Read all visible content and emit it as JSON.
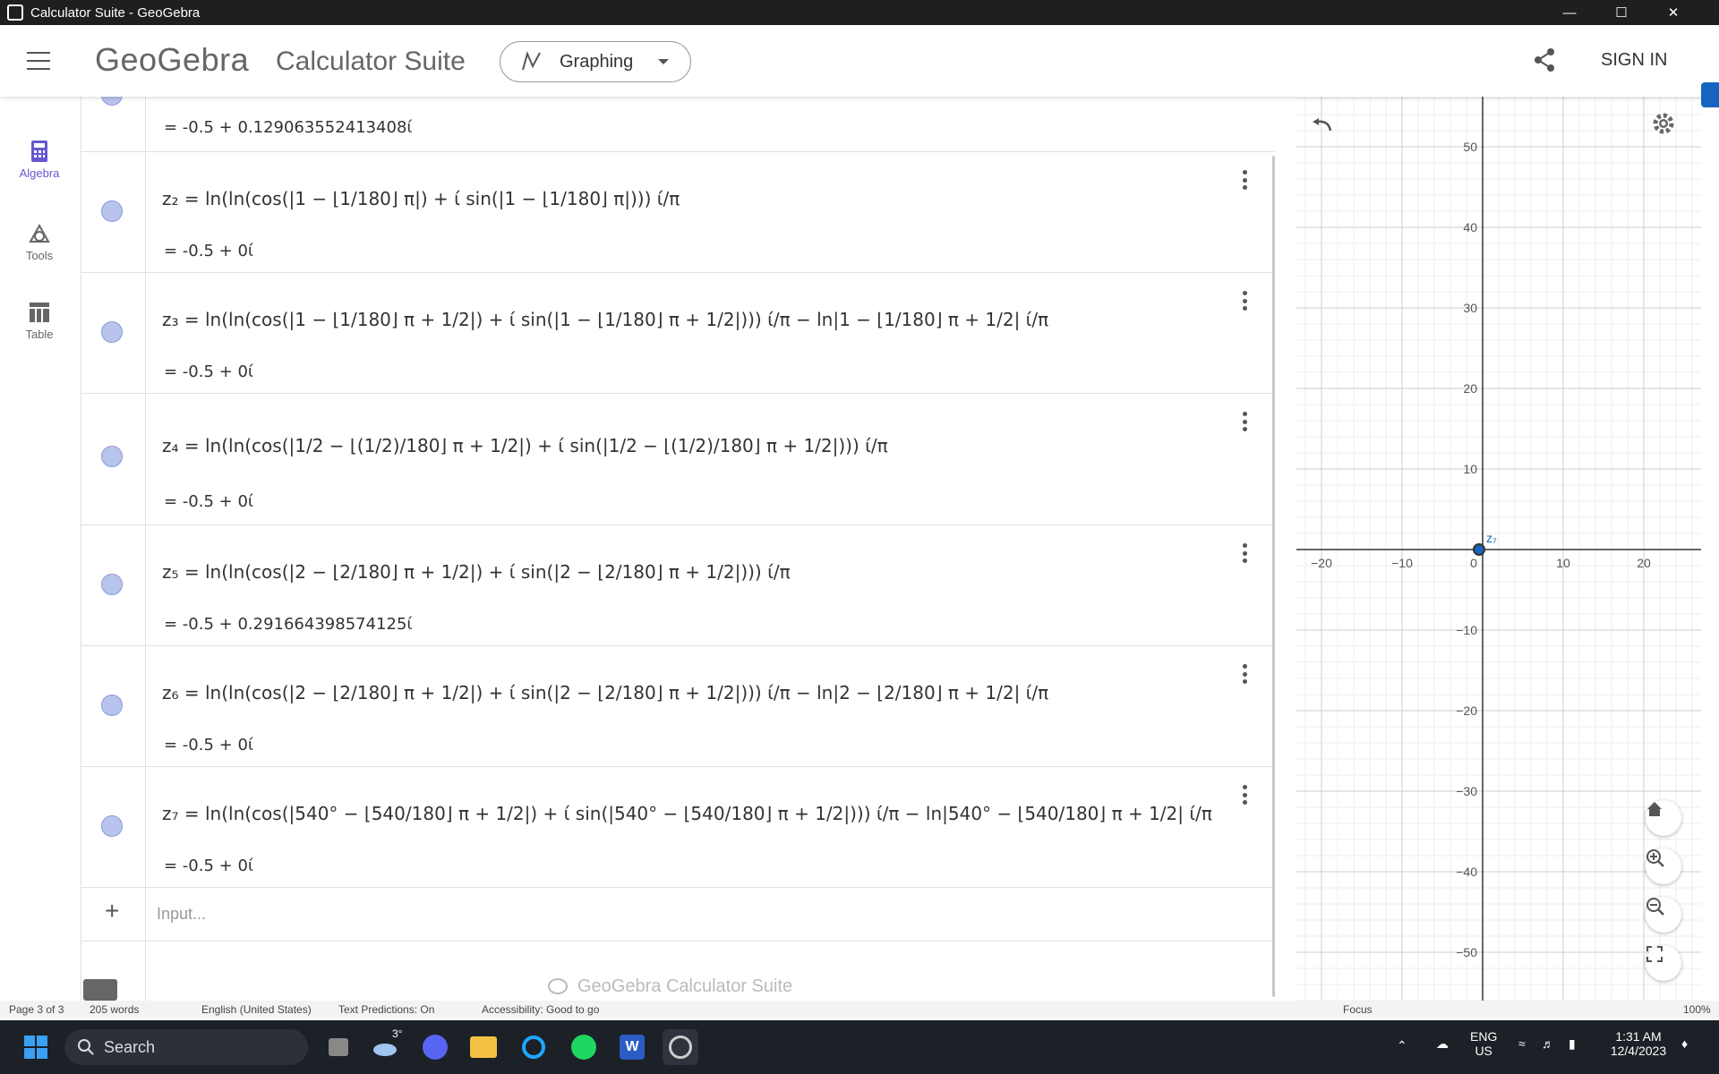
{
  "window": {
    "title": "Calculator Suite - GeoGebra"
  },
  "header": {
    "logo": "GeoGebra",
    "suite_title": "Calculator Suite",
    "app_picker_label": "Graphing",
    "signin_label": "SIGN IN"
  },
  "rail": {
    "items": [
      {
        "label": "Algebra",
        "icon": "calculator-icon"
      },
      {
        "label": "Tools",
        "icon": "tools-icon"
      },
      {
        "label": "Table",
        "icon": "table-icon"
      }
    ]
  },
  "algebra": {
    "rows": [
      {
        "formula": "",
        "result": "= -0.5 + 0.129063552413408ί"
      },
      {
        "formula": "z₂ = ln(ln(cos(|1 − ⌊1/180⌋ π|) + ί sin(|1 − ⌊1/180⌋ π|))) ί/π",
        "result": "= -0.5 + 0ί"
      },
      {
        "formula": "z₃ = ln(ln(cos(|1 − ⌊1/180⌋ π + 1/2|) + ί sin(|1 − ⌊1/180⌋ π + 1/2|))) ί/π − ln|1 − ⌊1/180⌋ π + 1/2| ί/π",
        "result": "= -0.5 + 0ί"
      },
      {
        "formula": "z₄ = ln(ln(cos(|1/2 − ⌊(1/2)/180⌋ π + 1/2|) + ί sin(|1/2 − ⌊(1/2)/180⌋ π + 1/2|))) ί/π",
        "result": "= -0.5 + 0ί"
      },
      {
        "formula": "z₅ = ln(ln(cos(|2 − ⌊2/180⌋ π + 1/2|) + ί sin(|2 − ⌊2/180⌋ π + 1/2|))) ί/π",
        "result": "= -0.5 + 0.291664398574125ί"
      },
      {
        "formula": "z₆ = ln(ln(cos(|2 − ⌊2/180⌋ π + 1/2|) + ί sin(|2 − ⌊2/180⌋ π + 1/2|))) ί/π − ln|2 − ⌊2/180⌋ π + 1/2| ί/π",
        "result": "= -0.5 + 0ί"
      },
      {
        "formula": "z₇ = ln(ln(cos(|540° − ⌊540/180⌋ π + 1/2|) + ί sin(|540° − ⌊540/180⌋ π + 1/2|))) ί/π − ln|540° − ⌊540/180⌋ π + 1/2| ί/π",
        "result": "= -0.5 + 0ί"
      }
    ],
    "input_placeholder": "Input...",
    "footer_brand": "GeoGebra Calculator Suite"
  },
  "graphics": {
    "x_ticks": [
      "−20",
      "−10",
      "0",
      "10",
      "20"
    ],
    "y_ticks": [
      "50",
      "40",
      "30",
      "20",
      "10",
      "−10",
      "−20",
      "−30",
      "−40",
      "−50"
    ],
    "point_label": "z₇"
  },
  "word_status": {
    "page": "Page 3 of 3",
    "words": "205 words",
    "language": "English (United States)",
    "predictions": "Text Predictions: On",
    "accessibility": "Accessibility: Good to go",
    "focus": "Focus",
    "zoom": "100%"
  },
  "taskbar": {
    "search_label": "Search",
    "weather": "3°",
    "lang_line1": "ENG",
    "lang_line2": "US",
    "time": "1:31 AM",
    "date": "12/4/2023"
  },
  "colors": {
    "accent": "#6557d2",
    "point": "#1565c0",
    "dot_fill": "#b8c4ec"
  }
}
